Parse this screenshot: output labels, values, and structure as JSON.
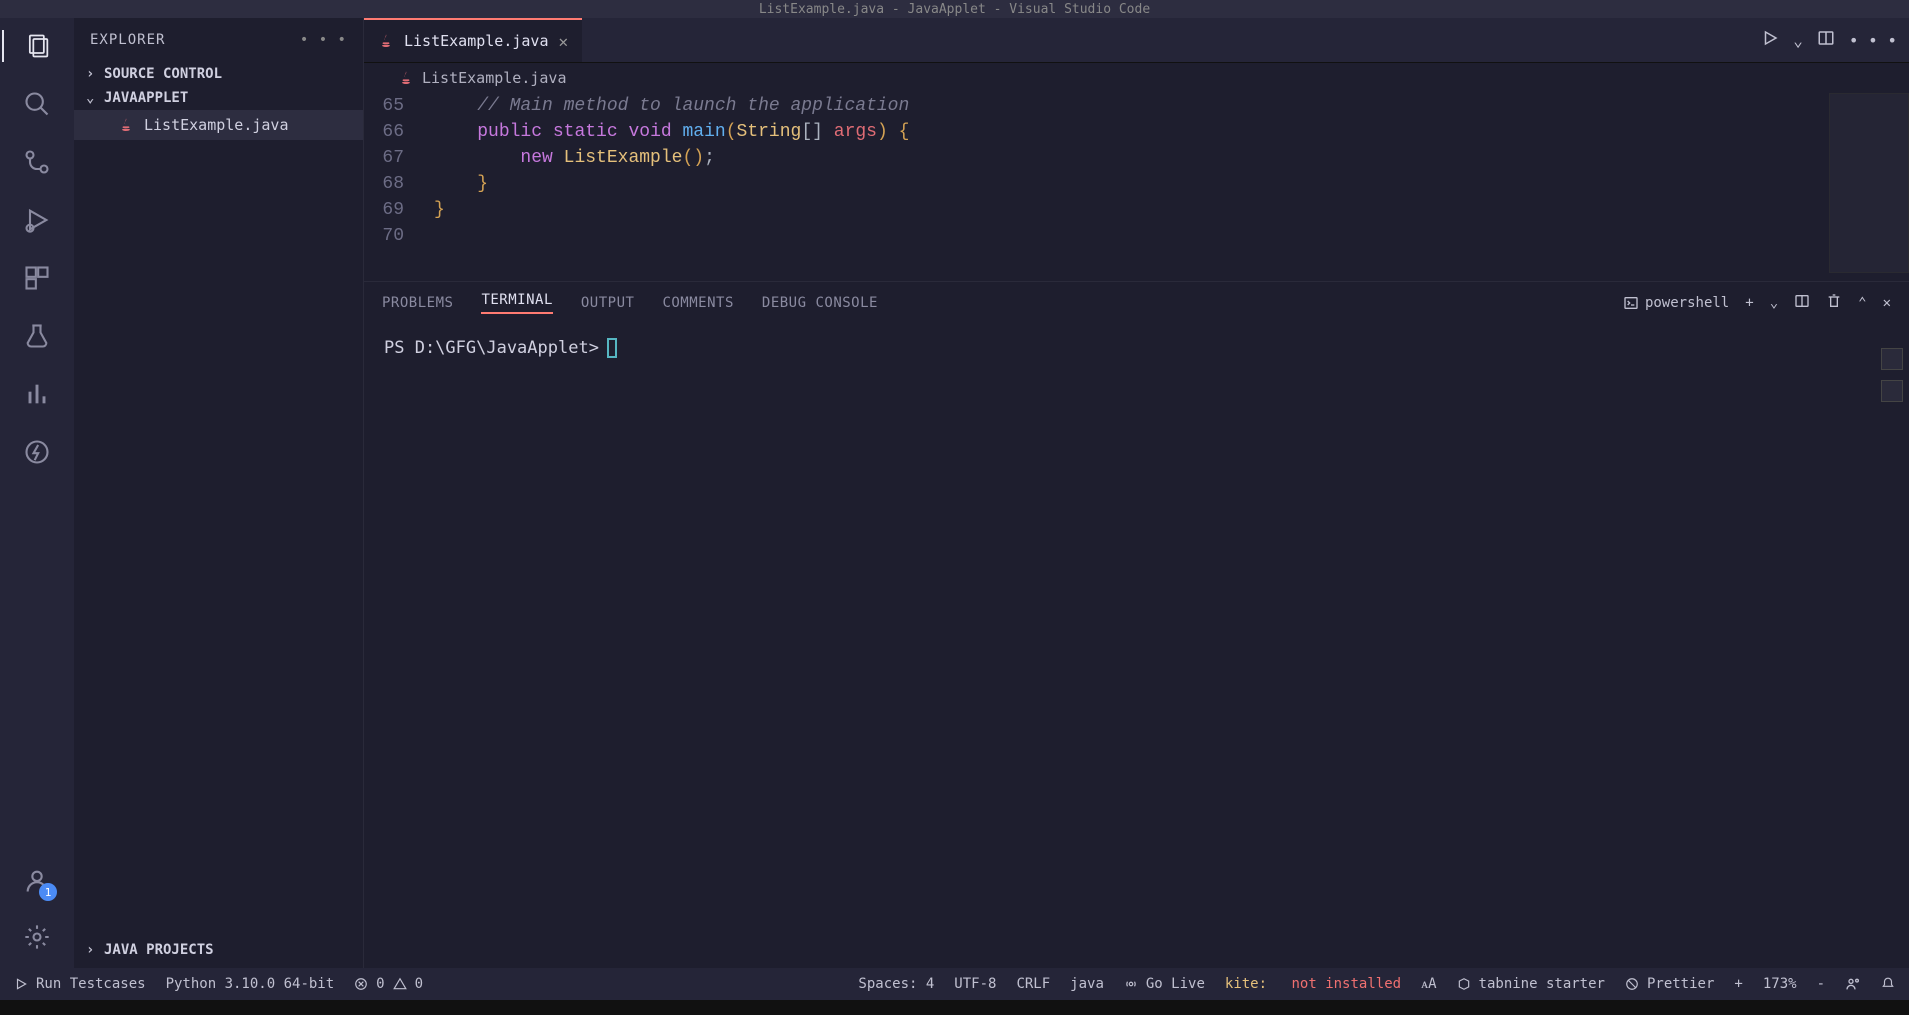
{
  "title": "ListExample.java - JavaApplet - Visual Studio Code",
  "explorer": {
    "title": "EXPLORER",
    "sections": {
      "source_control": "SOURCE CONTROL",
      "workspace": "JAVAAPPLET",
      "java_projects": "JAVA PROJECTS"
    },
    "file": "ListExample.java"
  },
  "tab": {
    "label": "ListExample.java",
    "breadcrumb": "ListExample.java"
  },
  "code": {
    "lines": [
      "65",
      "66",
      "67",
      "68",
      "69",
      "70"
    ],
    "l65_comment": "// Main method to launch the application",
    "l66_public": "public",
    "l66_static": "static",
    "l66_void": "void",
    "l66_main": "main",
    "l66_string": "String",
    "l66_brackets": "[]",
    "l66_args": "args",
    "l67_new": "new",
    "l67_class": "ListExample"
  },
  "panel": {
    "tabs": {
      "problems": "PROBLEMS",
      "terminal": "TERMINAL",
      "output": "OUTPUT",
      "comments": "COMMENTS",
      "debug": "DEBUG CONSOLE"
    },
    "terminal_name": "powershell",
    "prompt": "PS D:\\GFG\\JavaApplet>"
  },
  "status": {
    "run_testcases": "Run Testcases",
    "python": "Python 3.10.0 64-bit",
    "errors": "0",
    "warnings": "0",
    "spaces": "Spaces: 4",
    "encoding": "UTF-8",
    "eol": "CRLF",
    "lang": "java",
    "golive": "Go Live",
    "kite_label": "kite:",
    "kite_status": "not installed",
    "tabnine": "tabnine starter",
    "prettier": "Prettier",
    "zoom": "173%",
    "accounts_badge": "1"
  }
}
